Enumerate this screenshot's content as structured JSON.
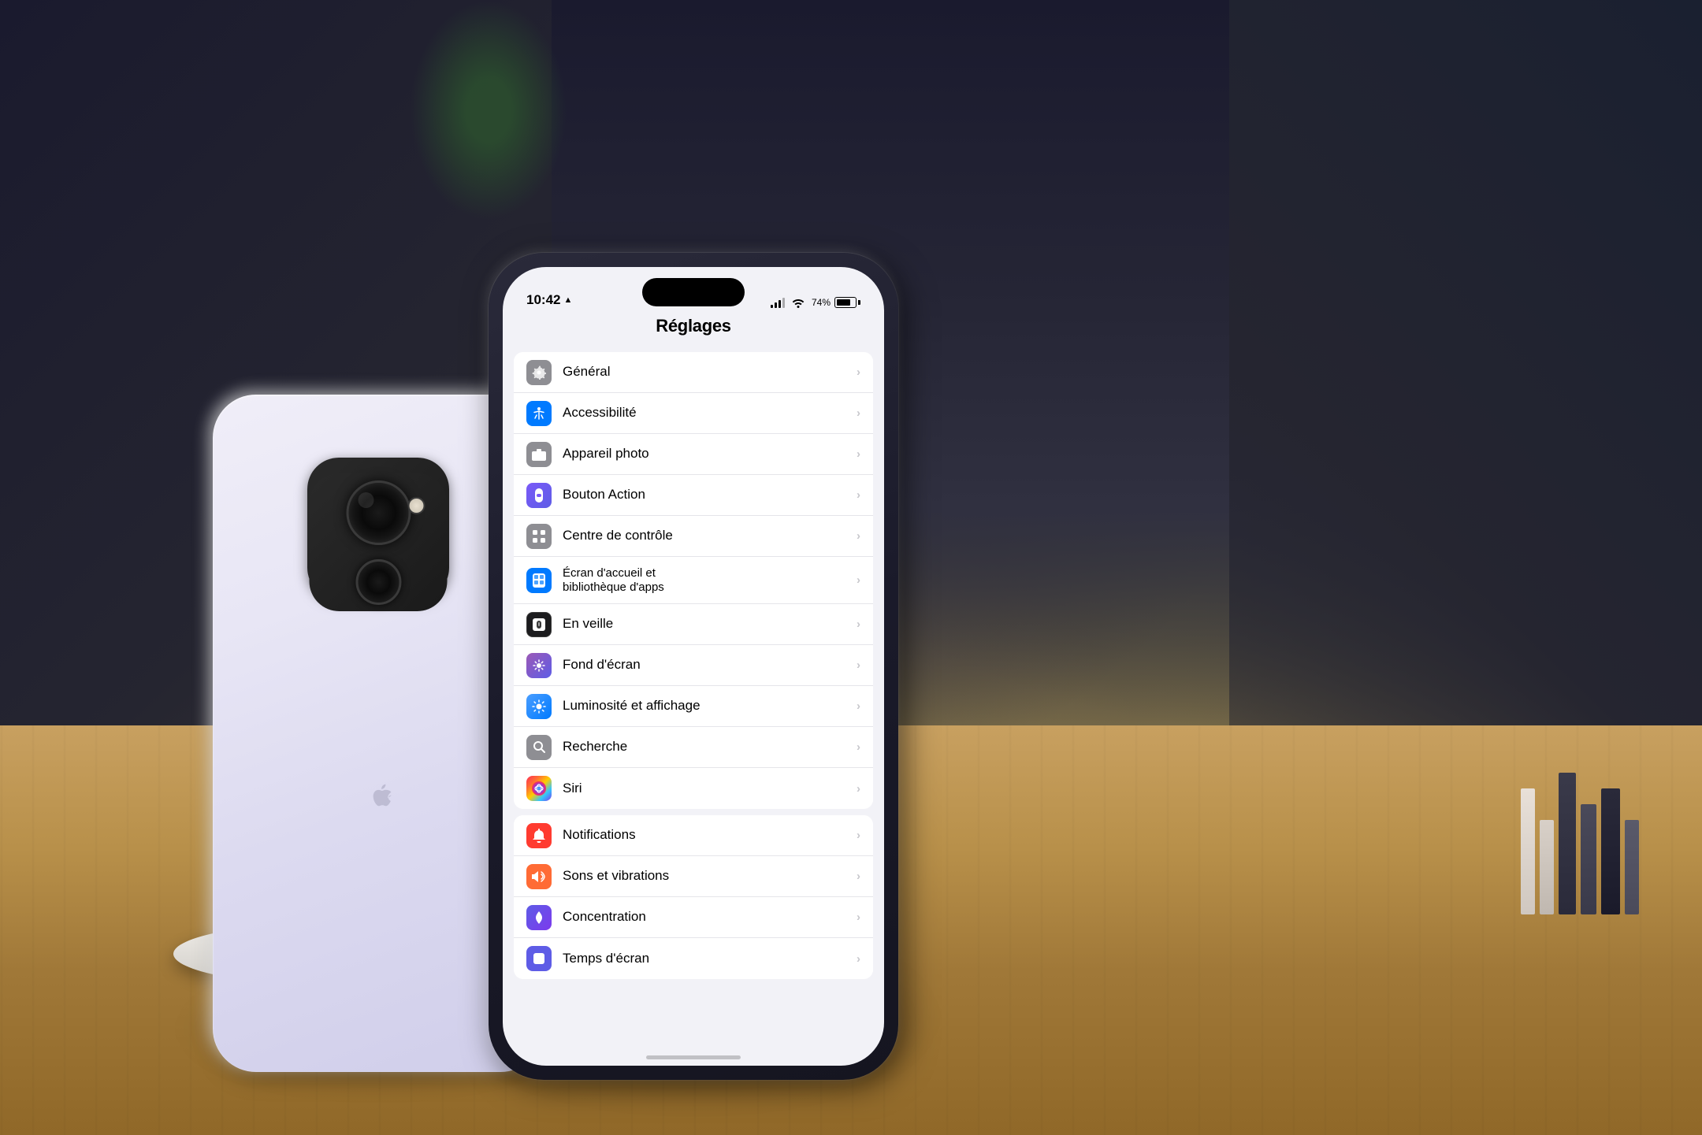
{
  "background": {
    "color": "#3a3530"
  },
  "phone_back": {
    "alt": "iPhone 16 white back"
  },
  "phone_front": {
    "alt": "iPhone 16 Pro showing Settings screen"
  },
  "screen": {
    "status_bar": {
      "time": "10:42",
      "location_icon": "▲",
      "battery_level": "74",
      "battery_percent": "74%"
    },
    "page_title": "Réglages",
    "sections": [
      {
        "id": "section1",
        "items": [
          {
            "id": "general",
            "icon_bg": "#8e8e93",
            "icon": "⚙",
            "label": "Général",
            "icon_emoji": "⚙️"
          },
          {
            "id": "accessibility",
            "icon_bg": "#007aff",
            "icon": "♿",
            "label": "Accessibilité"
          },
          {
            "id": "camera",
            "icon_bg": "#8e8e93",
            "icon": "📷",
            "label": "Appareil photo"
          },
          {
            "id": "action_button",
            "icon_bg": "#5e5ce6",
            "icon": "✦",
            "label": "Bouton Action"
          },
          {
            "id": "control_center",
            "icon_bg": "#8e8e93",
            "icon": "⊞",
            "label": "Centre de contrôle"
          },
          {
            "id": "home_screen",
            "icon_bg": "#007aff",
            "icon": "⊟",
            "label": "Écran d'accueil et\nbibliothèque d'apps",
            "multiline": true
          },
          {
            "id": "standby",
            "icon_bg": "#1c1c1e",
            "icon": "⊙",
            "label": "En veille"
          },
          {
            "id": "wallpaper",
            "icon_bg": "#5e5ce6",
            "icon": "✿",
            "label": "Fond d'écran"
          },
          {
            "id": "display",
            "icon_bg": "#4a9eff",
            "icon": "☀",
            "label": "Luminosité et affichage"
          },
          {
            "id": "search",
            "icon_bg": "#8e8e93",
            "icon": "🔍",
            "label": "Recherche"
          },
          {
            "id": "siri",
            "icon_bg": "gradient",
            "icon": "◎",
            "label": "Siri"
          }
        ]
      },
      {
        "id": "section2",
        "items": [
          {
            "id": "notifications",
            "icon_bg": "#ff3b30",
            "icon": "🔔",
            "label": "Notifications"
          },
          {
            "id": "sounds",
            "icon_bg": "#ff6b35",
            "icon": "🔊",
            "label": "Sons et vibrations"
          },
          {
            "id": "focus",
            "icon_bg": "#5e5ce6",
            "icon": "🌙",
            "label": "Concentration"
          },
          {
            "id": "screen_time",
            "icon_bg": "#5e5ce6",
            "icon": "⏱",
            "label": "Temps d'écran"
          }
        ]
      }
    ]
  }
}
